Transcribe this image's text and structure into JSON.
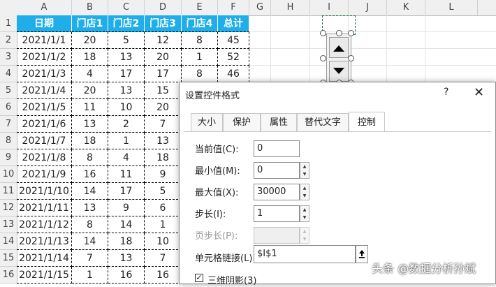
{
  "columns": [
    "A",
    "B",
    "C",
    "D",
    "E",
    "F",
    "G",
    "H",
    "I",
    "J",
    "K",
    "L"
  ],
  "rows": [
    "1",
    "2",
    "3",
    "4",
    "5",
    "6",
    "7",
    "8",
    "9",
    "10",
    "11",
    "12",
    "13",
    "14",
    "15",
    "16"
  ],
  "table": {
    "header": [
      "日期",
      "门店1",
      "门店2",
      "门店3",
      "门店4",
      "总计"
    ],
    "dates": [
      "2021/1/1",
      "2021/1/2",
      "2021/1/3",
      "2021/1/4",
      "2021/1/5",
      "2021/1/6",
      "2021/1/7",
      "2021/1/8",
      "2021/1/9",
      "2021/1/10",
      "2021/1/11",
      "2021/1/12",
      "2021/1/13",
      "2021/1/14",
      "2021/1/15"
    ],
    "store1": [
      "20",
      "18",
      "4",
      "20",
      "11",
      "13",
      "18",
      "8",
      "16",
      "14",
      "13",
      "8",
      "14",
      "7",
      "1"
    ],
    "store2": [
      "5",
      "13",
      "17",
      "13",
      "10",
      "2",
      "1",
      "4",
      "11",
      "17",
      "9",
      "14",
      "18",
      "13",
      "16"
    ],
    "store3": [
      "12",
      "20",
      "17",
      "15",
      "20",
      "7",
      "13",
      "18",
      "9",
      "5",
      "6",
      "1",
      "10",
      "7",
      "16"
    ],
    "store4": [
      "8",
      "1",
      "8"
    ],
    "total": [
      "45",
      "52",
      "46"
    ]
  },
  "dialog": {
    "title": "设置控件格式",
    "help": "?",
    "close": "✕",
    "tabs": [
      "大小",
      "保护",
      "属性",
      "替代文字",
      "控制"
    ],
    "fields": {
      "current_label": "当前值(C):",
      "current_value": "0",
      "min_label": "最小值(M):",
      "min_value": "0",
      "max_label": "最大值(X):",
      "max_value": "30000",
      "step_label": "步长(I):",
      "step_value": "1",
      "page_label": "页步长(P):",
      "page_value": "",
      "link_label": "单元格链接(L):",
      "link_value": "$I$1"
    },
    "shadow_label": "三维阴影(3)",
    "shadow_check": "✓"
  },
  "watermark": "头条 @数据分析孙斌",
  "colors": {
    "header_bg": "#1faee9",
    "marker": "#1a8a3a"
  }
}
